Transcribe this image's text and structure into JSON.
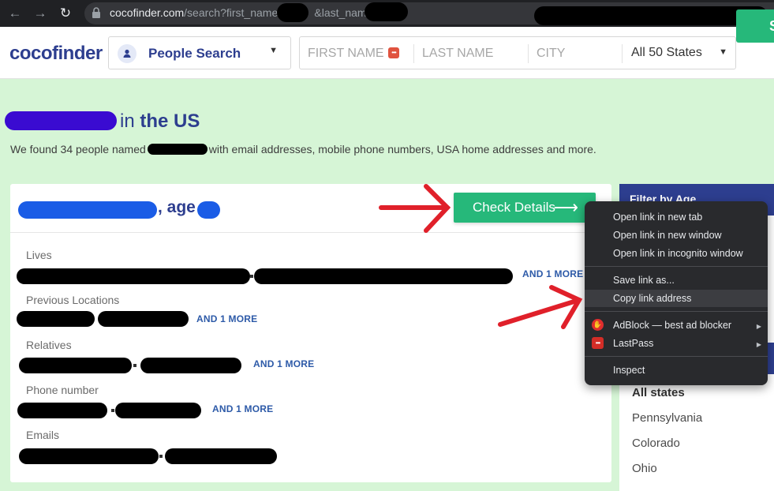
{
  "browser": {
    "back_icon": "arrow-left-icon",
    "forward_icon": "arrow-right-icon",
    "reload_icon": "reload-icon",
    "url_host": "cocofinder.com",
    "url_path_1": "/search?first_name=",
    "url_path_2": "&last_name"
  },
  "header": {
    "logo_main": "cocofinder",
    "search_type": "People Search",
    "first_name_placeholder": "FIRST NAME",
    "last_name_placeholder": "LAST NAME",
    "city_placeholder": "CITY",
    "state_value": "All 50 States",
    "search_button": "S"
  },
  "results": {
    "heading_in": "in ",
    "heading_region": "the US",
    "subtitle_prefix": "We found 34 people named",
    "subtitle_suffix": "with email addresses, mobile phone numbers, USA home addresses and more."
  },
  "card": {
    "age_label": ", age",
    "check_details": "Check Details",
    "check_arrow": "⟶",
    "fields": {
      "lives": "Lives",
      "previous_locations": "Previous Locations",
      "relatives": "Relatives",
      "phone_number": "Phone number",
      "emails": "Emails"
    },
    "more_label": "AND 1 MORE"
  },
  "filter": {
    "age_title": "Filter by Age",
    "states": [
      "All states",
      "Pennsylvania",
      "Colorado",
      "Ohio"
    ]
  },
  "context_menu": {
    "items": [
      "Open link in new tab",
      "Open link in new window",
      "Open link in incognito window",
      "Save link as...",
      "Copy link address",
      "AdBlock — best ad blocker",
      "LastPass",
      "Inspect"
    ]
  },
  "colors": {
    "brand_blue": "#2d3e8f",
    "brand_green": "#26b87a",
    "page_bg": "#d6f5d6",
    "annotation_red": "#e0202a"
  }
}
